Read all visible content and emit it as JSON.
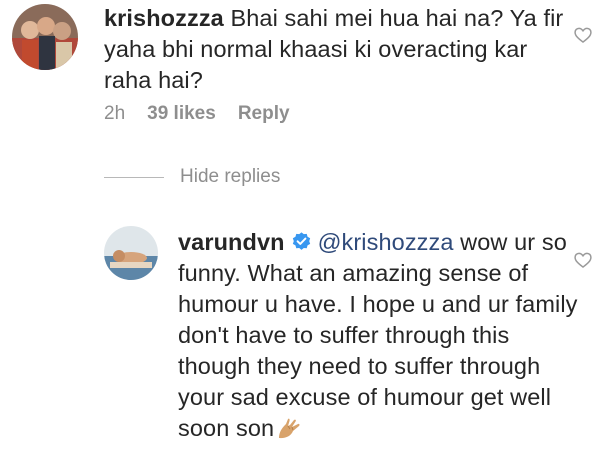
{
  "comment": {
    "avatar_icon": "profile-photo-group",
    "username": "krishozzza",
    "text": " Bhai sahi mei hua hai na? Ya fir yaha bhi normal khaasi ki overacting kar raha hai?",
    "time": "2h",
    "likes": "39 likes",
    "reply_label": "Reply",
    "like_icon": "heart-outline-icon"
  },
  "hide_replies_label": "Hide replies",
  "reply": {
    "avatar_icon": "profile-photo-varundvn",
    "username": "varundvn",
    "verified_icon": "verified-badge-icon",
    "mention": "@krishozzza",
    "text": " wow ur so funny. What an amazing sense of humour u have. I hope u and ur family don't have to suffer through this though they need to suffer through your sad excuse of humour get well soon son",
    "emoji_icon": "folded-hands-emoji",
    "like_icon": "heart-outline-icon"
  },
  "colors": {
    "text": "#262626",
    "muted": "#8e8e8e",
    "verified": "#3897f0",
    "mention": "#2f4a7a"
  }
}
